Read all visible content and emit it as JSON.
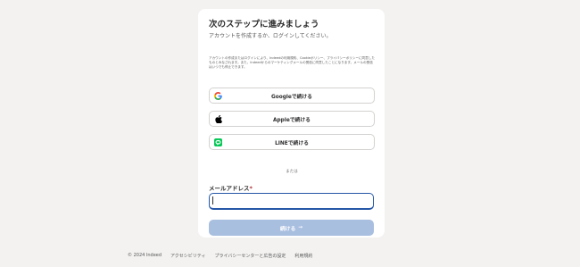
{
  "card": {
    "title": "次のステップに進みましょう",
    "subtitle": "アカウントを作成するか、ログインしてください。",
    "legal_text": "アカウントの作成またはログインにより、Indeedの利用規約、Cookieポリシー、プライバシーポリシーに同意したものとみなされます。また、Indeedからのマーケティングメールの受信に同意したことになります。メールの受信はいつでも停止できます。"
  },
  "sso": {
    "google_label": "Googleで続ける",
    "apple_label": "Appleで続ける",
    "line_label": "LINEで続ける"
  },
  "divider": {
    "or_label": "または"
  },
  "email": {
    "label": "メールアドレス",
    "required_mark": "*",
    "value": ""
  },
  "continue_button": {
    "label": "続ける",
    "arrow": "→"
  },
  "footer": {
    "copyright": "© 2024 Indeed",
    "accessibility": "アクセシビリティ",
    "privacy": "プライバシーセンターと広告の設定",
    "terms": "利用規約"
  },
  "colors": {
    "accent": "#2557a7",
    "button_disabled": "#a9bfe0",
    "line_green": "#06c755",
    "background": "#f3f2f1"
  },
  "icons": [
    "google-icon",
    "apple-icon",
    "line-icon"
  ]
}
